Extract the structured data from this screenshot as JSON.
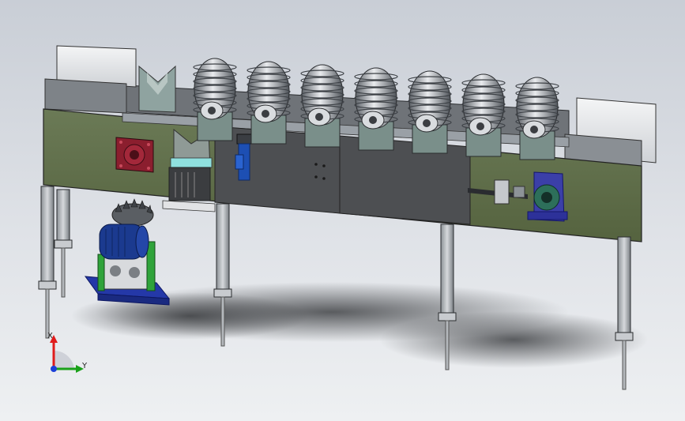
{
  "viewport": {
    "background_top": "#c9ced6",
    "background_bottom": "#eef0f2",
    "model": {
      "frame_color": "#5d6a4a",
      "panel_color": "#4b4d50",
      "cover_color": "#e9eaec",
      "roller_color": "#6d7278",
      "motor_color": "#1b3a8f",
      "bearing_color": "#8b1e2e",
      "base_color": "#2438a8",
      "bracket_color": "#2fa33a",
      "roller_count": 7,
      "leg_count": 5
    }
  },
  "triad": {
    "x_label": "X",
    "y_label": "Y",
    "x_color": "#e01b1b",
    "y_color": "#1aa11a",
    "z_color": "#1b3fd8"
  }
}
